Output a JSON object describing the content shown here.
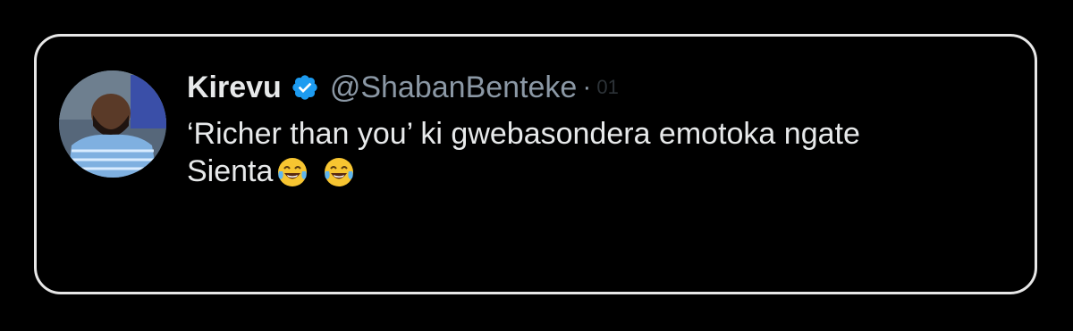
{
  "tweet": {
    "author": {
      "display_name": "Kirevu",
      "handle": "@ShabanBenteke",
      "verified": true,
      "separator": "·",
      "timestamp_partial": "01"
    },
    "text_line1": "‘Richer than you’ ki gwebasondera emotoka ngate",
    "text_line2": "Sienta",
    "emojis": [
      "face-with-tears-of-joy",
      "face-with-tears-of-joy"
    ]
  },
  "colors": {
    "background": "#000000",
    "card_border": "#e7e7e7",
    "text_primary": "#e7e9ea",
    "text_secondary": "#8b98a5",
    "verified_blue": "#1d9bf0"
  }
}
